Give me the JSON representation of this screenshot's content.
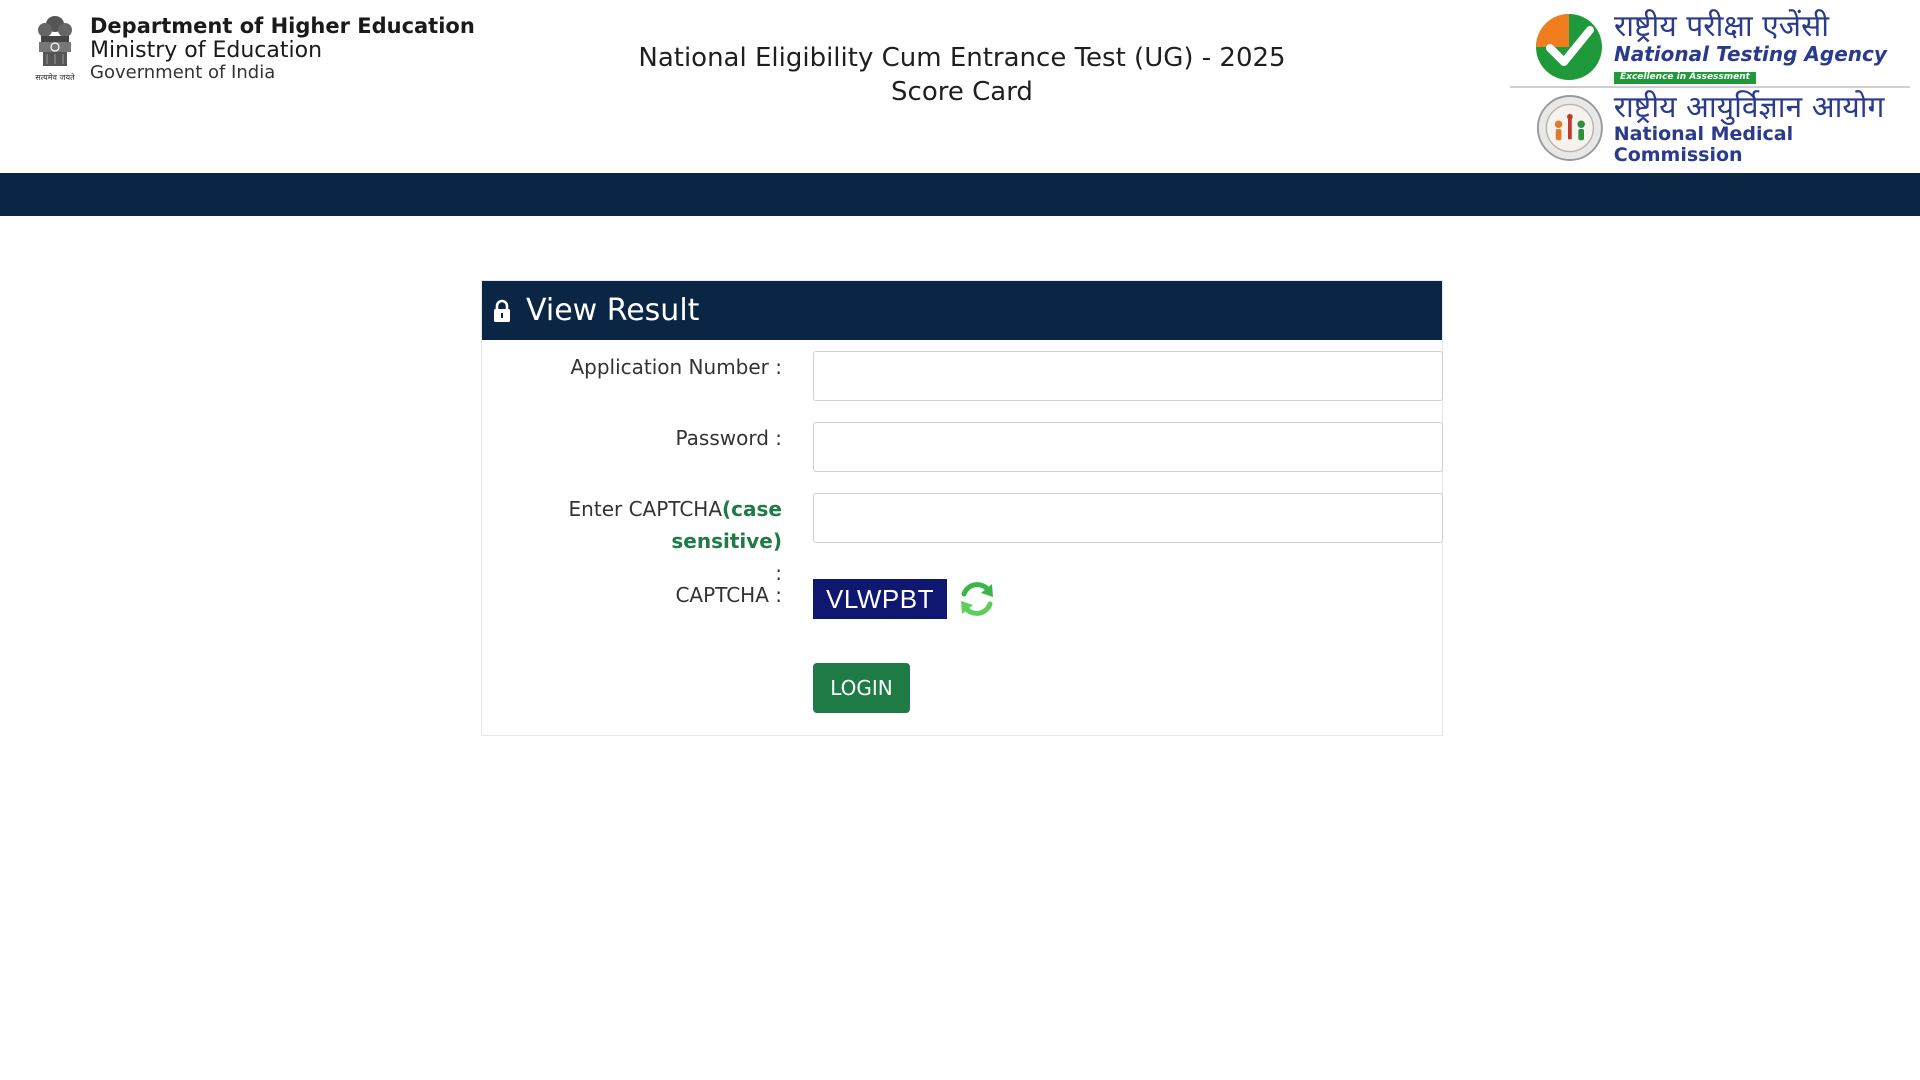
{
  "ministry": {
    "line1": "Department of Higher Education",
    "line2": "Ministry of Education",
    "line3": "Government of India",
    "emblem_motto": "सत्यमेव जयते"
  },
  "exam": {
    "title_line1": "National Eligibility Cum Entrance Test (UG) - 2025",
    "title_line2": "Score Card"
  },
  "nta": {
    "hindi": "राष्ट्रीय परीक्षा एजेंसी",
    "english": "National Testing Agency",
    "tagline": "Excellence in Assessment"
  },
  "nmc": {
    "hindi": "राष्ट्रीय आयुर्विज्ञान आयोग",
    "english": "National Medical Commission"
  },
  "card": {
    "title": "View Result",
    "icon": "lock-icon"
  },
  "form": {
    "application_label": "Application Number :",
    "application_value": "",
    "password_label": "Password :",
    "password_value": "",
    "captcha_input_label_prefix": "Enter CAPTCHA",
    "captcha_input_label_note": "(case sensitive)",
    "captcha_input_label_suffix": ":",
    "captcha_input_value": "",
    "captcha_label": "CAPTCHA :",
    "captcha_text": "VLWPBT",
    "refresh_icon": "refresh-icon",
    "login_label": "LOGIN"
  },
  "colors": {
    "navy": "#0b2545",
    "green": "#1e7b45",
    "captcha_bg": "#0f1770"
  }
}
